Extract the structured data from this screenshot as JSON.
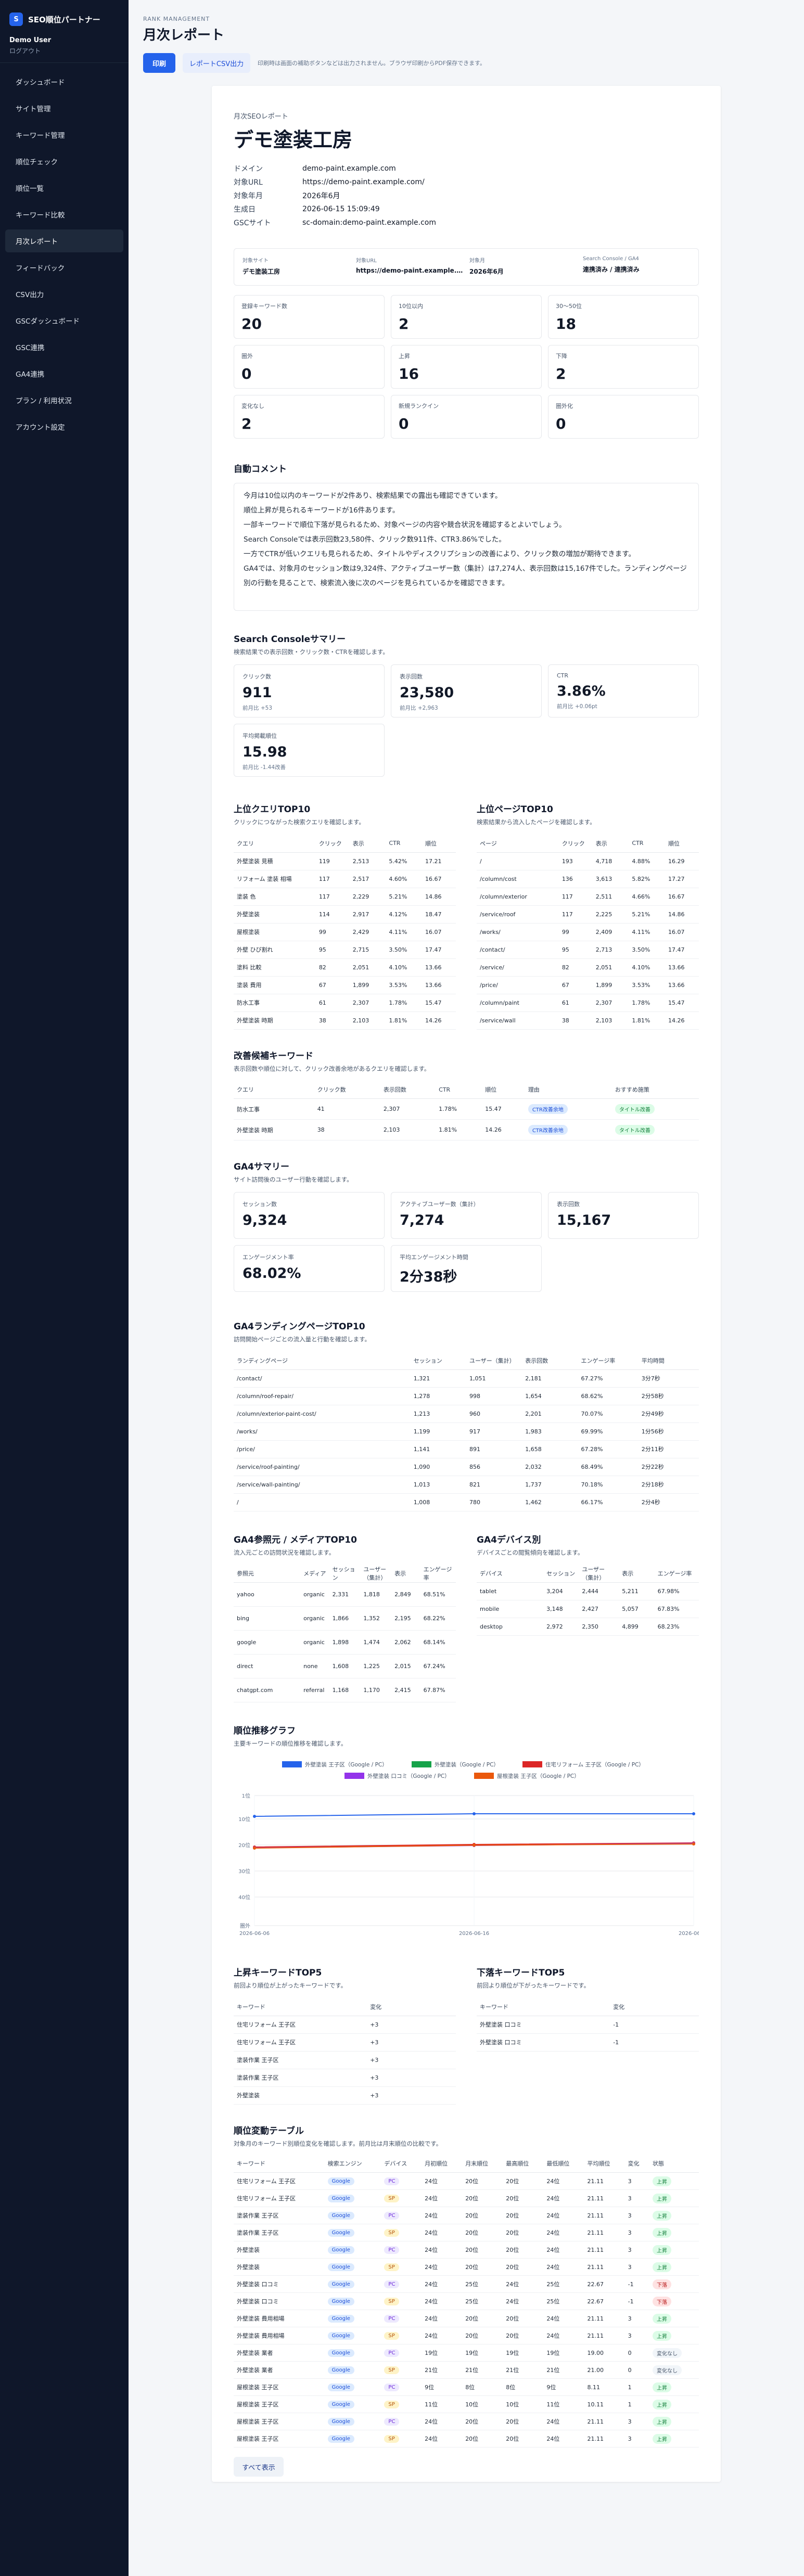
{
  "sidebar": {
    "brand_mark": "S",
    "brand": "SEO順位パートナー",
    "user": "Demo User",
    "logout": "ログアウト",
    "items": [
      "ダッシュボード",
      "サイト管理",
      "キーワード管理",
      "順位チェック",
      "順位一覧",
      "キーワード比較",
      "月次レポート",
      "フィードバック",
      "CSV出力",
      "GSCダッシュボード",
      "GSC連携",
      "GA4連携",
      "プラン / 利用状況",
      "アカウント設定"
    ],
    "active_index": 6
  },
  "header": {
    "crumb": "RANK MANAGEMENT",
    "title": "月次レポート",
    "print": "印刷",
    "csv": "レポートCSV出力",
    "tip": "印刷時は画面の補助ボタンなどは出力されません。ブラウザ印刷からPDF保存できます。"
  },
  "report": {
    "subtitle": "月次SEOレポート",
    "title": "デモ塗装工房",
    "meta": [
      [
        "ドメイン",
        "demo-paint.example.com"
      ],
      [
        "対象URL",
        "https://demo-paint.example.com/"
      ],
      [
        "対象年月",
        "2026年6月"
      ],
      [
        "生成日",
        "2026-06-15 15:09:49"
      ],
      [
        "GSCサイト",
        "sc-domain:demo-paint.example.com"
      ]
    ],
    "info": [
      [
        "対象サイト",
        "デモ塗装工房"
      ],
      [
        "対象URL",
        "https://demo-paint.example.com/"
      ],
      [
        "対象月",
        "2026年6月"
      ],
      [
        "Search Console / GA4",
        "連携済み / 連携済み"
      ]
    ],
    "stats": [
      [
        "登録キーワード数",
        "20"
      ],
      [
        "10位以内",
        "2"
      ],
      [
        "圏外",
        ""
      ],
      [
        "圏外",
        "0"
      ],
      [
        "上昇",
        "16"
      ],
      [
        "下降",
        "2"
      ],
      [
        "変化なし",
        "2"
      ],
      [
        "新規ランクイン",
        "0"
      ],
      [
        "圏外化",
        "0"
      ]
    ],
    "stats_fix": {
      "third_label": "30～50位",
      "third_value": "18"
    },
    "comment_title": "自動コメント",
    "comment": [
      "今月は10位以内のキーワードが2件あり、検索結果での露出も確認できています。",
      "順位上昇が見られるキーワードが16件あります。",
      "一部キーワードで順位下落が見られるため、対象ページの内容や競合状況を確認するとよいでしょう。",
      "Search Consoleでは表示回数23,580件、クリック数911件、CTR3.86%でした。",
      "一方でCTRが低いクエリも見られるため、タイトルやディスクリプションの改善により、クリック数の増加が期待できます。",
      "GA4では、対象月のセッション数は9,324件、アクティブユーザー数（集計）は7,274人、表示回数は15,167件でした。ランディングページ別の行動を見ることで、検索流入後に次のページを見られているかを確認できます。"
    ],
    "gsc": {
      "title": "Search Consoleサマリー",
      "sub": "検索結果での表示回数・クリック数・CTRを確認します。",
      "cards": [
        [
          "クリック数",
          "911",
          "前月比 +53"
        ],
        [
          "表示回数",
          "23,580",
          "前月比 +2,963"
        ],
        [
          "CTR",
          "3.86%",
          "前月比 +0.06pt"
        ],
        [
          "平均掲載順位",
          "15.98",
          "前月比 -1.44改善"
        ]
      ]
    },
    "queries": {
      "title": "上位クエリTOP10",
      "sub": "クリックにつながった検索クエリを確認します。",
      "cols": [
        "クエリ",
        "クリック",
        "表示",
        "CTR",
        "順位"
      ],
      "rows": [
        [
          "外壁塗装 見積",
          "119",
          "2,513",
          "5.42%",
          "17.21"
        ],
        [
          "リフォーム 塗装 相場",
          "117",
          "2,517",
          "4.60%",
          "16.67"
        ],
        [
          "塗装 色",
          "117",
          "2,229",
          "5.21%",
          "14.86"
        ],
        [
          "外壁塗装",
          "114",
          "2,917",
          "4.12%",
          "18.47"
        ],
        [
          "屋根塗装",
          "99",
          "2,429",
          "4.11%",
          "16.07"
        ],
        [
          "外壁 ひび割れ",
          "95",
          "2,715",
          "3.50%",
          "17.47"
        ],
        [
          "塗料 比較",
          "82",
          "2,051",
          "4.10%",
          "13.66"
        ],
        [
          "塗装 費用",
          "67",
          "1,899",
          "3.53%",
          "13.66"
        ],
        [
          "防水工事",
          "61",
          "2,307",
          "1.78%",
          "15.47"
        ],
        [
          "外壁塗装 時期",
          "38",
          "2,103",
          "1.81%",
          "14.26"
        ]
      ]
    },
    "pages": {
      "title": "上位ページTOP10",
      "sub": "検索結果から流入したページを確認します。",
      "cols": [
        "ページ",
        "クリック",
        "表示",
        "CTR",
        "順位"
      ],
      "rows": [
        [
          "/",
          "193",
          "4,718",
          "4.88%",
          "16.29"
        ],
        [
          "/column/cost",
          "136",
          "3,613",
          "5.82%",
          "17.27"
        ],
        [
          "/column/exterior",
          "117",
          "2,511",
          "4.66%",
          "16.67"
        ],
        [
          "/service/roof",
          "117",
          "2,225",
          "5.21%",
          "14.86"
        ],
        [
          "/works/",
          "99",
          "2,409",
          "4.11%",
          "16.07"
        ],
        [
          "/contact/",
          "95",
          "2,713",
          "3.50%",
          "17.47"
        ],
        [
          "/service/",
          "82",
          "2,051",
          "4.10%",
          "13.66"
        ],
        [
          "/price/",
          "67",
          "1,899",
          "3.53%",
          "13.66"
        ],
        [
          "/column/paint",
          "61",
          "2,307",
          "1.78%",
          "15.47"
        ],
        [
          "/service/wall",
          "38",
          "2,103",
          "1.81%",
          "14.26"
        ]
      ]
    },
    "improve": {
      "title": "改善候補キーワード",
      "sub": "表示回数や順位に対して、クリック改善余地があるクエリを確認します。",
      "cols": [
        "クエリ",
        "クリック数",
        "表示回数",
        "CTR",
        "順位",
        "理由",
        "おすすめ施策"
      ],
      "rows": [
        [
          "防水工事",
          "41",
          "2,307",
          "1.78%",
          "15.47",
          "CTR改善余地",
          "タイトル改善"
        ],
        [
          "外壁塗装 時期",
          "38",
          "2,103",
          "1.81%",
          "14.26",
          "CTR改善余地",
          "タイトル改善"
        ]
      ]
    },
    "ga4": {
      "title": "GA4サマリー",
      "sub": "サイト訪問後のユーザー行動を確認します。",
      "cards": [
        [
          "セッション数",
          "9,324"
        ],
        [
          "アクティブユーザー数（集計）",
          "7,274"
        ],
        [
          "表示回数",
          "15,167"
        ],
        [
          "エンゲージメント率",
          "68.02%"
        ],
        [
          "平均エンゲージメント時間",
          "2分38秒"
        ]
      ]
    },
    "landing": {
      "title": "GA4ランディングページTOP10",
      "sub": "訪問開始ページごとの流入量と行動を確認します。",
      "cols": [
        "ランディングページ",
        "セッション",
        "ユーザー（集計）",
        "表示回数",
        "エンゲージ率",
        "平均時間"
      ],
      "rows": [
        [
          "/contact/",
          "1,321",
          "1,051",
          "2,181",
          "67.27%",
          "3分7秒"
        ],
        [
          "/column/roof-repair/",
          "1,278",
          "998",
          "1,654",
          "68.62%",
          "2分58秒"
        ],
        [
          "/column/exterior-paint-cost/",
          "1,213",
          "960",
          "2,201",
          "70.07%",
          "2分49秒"
        ],
        [
          "/works/",
          "1,199",
          "917",
          "1,983",
          "69.99%",
          "1分56秒"
        ],
        [
          "/price/",
          "1,141",
          "891",
          "1,658",
          "67.28%",
          "2分11秒"
        ],
        [
          "/service/roof-painting/",
          "1,090",
          "856",
          "2,032",
          "68.49%",
          "2分22秒"
        ],
        [
          "/service/wall-painting/",
          "1,013",
          "821",
          "1,737",
          "70.18%",
          "2分18秒"
        ],
        [
          "/",
          "1,008",
          "780",
          "1,462",
          "66.17%",
          "2分4秒"
        ]
      ]
    },
    "sources": {
      "title": "GA4参照元 / メディアTOP10",
      "sub": "流入元ごとの訪問状況を確認します。",
      "cols": [
        "参照元",
        "メディア",
        "セッション",
        "ユーザー（集計）",
        "表示",
        "エンゲージ率"
      ],
      "rows": [
        [
          "yahoo",
          "organic",
          "2,331",
          "1,818",
          "2,849",
          "68.51%"
        ],
        [
          "bing",
          "organic",
          "1,866",
          "1,352",
          "2,195",
          "68.22%"
        ],
        [
          "google",
          "organic",
          "1,898",
          "1,474",
          "2,062",
          "68.14%"
        ],
        [
          "direct",
          "none",
          "1,608",
          "1,225",
          "2,015",
          "67.24%"
        ],
        [
          "chatgpt.com",
          "referral",
          "1,168",
          "1,170",
          "2,415",
          "67.87%"
        ]
      ]
    },
    "devices": {
      "title": "GA4デバイス別",
      "sub": "デバイスごとの閲覧傾向を確認します。",
      "cols": [
        "デバイス",
        "セッション",
        "ユーザー（集計）",
        "表示",
        "エンゲージ率"
      ],
      "rows": [
        [
          "tablet",
          "3,204",
          "2,444",
          "5,211",
          "67.98%"
        ],
        [
          "mobile",
          "3,148",
          "2,427",
          "5,057",
          "67.83%"
        ],
        [
          "desktop",
          "2,972",
          "2,350",
          "4,899",
          "68.23%"
        ]
      ]
    },
    "rankchart": {
      "title": "順位推移グラフ",
      "sub": "主要キーワードの順位推移を確認します。"
    },
    "up5": {
      "title": "上昇キーワードTOP5",
      "sub": "前回より順位が上がったキーワードです。",
      "cols": [
        "キーワード",
        "変化"
      ],
      "rows": [
        [
          "住宅リフォーム 王子区",
          "+3"
        ],
        [
          "住宅リフォーム 王子区",
          "+3"
        ],
        [
          "塗装作業 王子区",
          "+3"
        ],
        [
          "塗装作業 王子区",
          "+3"
        ],
        [
          "外壁塗装",
          "+3"
        ]
      ]
    },
    "down5": {
      "title": "下落キーワードTOP5",
      "sub": "前回より順位が下がったキーワードです。",
      "cols": [
        "キーワード",
        "変化"
      ],
      "rows": [
        [
          "外壁塗装 口コミ",
          "-1"
        ],
        [
          "外壁塗装 口コミ",
          "-1"
        ]
      ]
    },
    "changes": {
      "title": "順位変動テーブル",
      "sub": "対象月のキーワード別順位変化を確認します。前月比は月末順位の比較です。",
      "cols": [
        "キーワード",
        "検索エンジン",
        "デバイス",
        "月初順位",
        "月末順位",
        "最高順位",
        "最低順位",
        "平均順位",
        "変化",
        "状態"
      ],
      "rows": [
        [
          "住宅リフォーム 王子区",
          "Google",
          "PC",
          "24位",
          "20位",
          "20位",
          "24位",
          "21.11",
          "3",
          "上昇"
        ],
        [
          "住宅リフォーム 王子区",
          "Google",
          "SP",
          "24位",
          "20位",
          "20位",
          "24位",
          "21.11",
          "3",
          "上昇"
        ],
        [
          "塗装作業 王子区",
          "Google",
          "PC",
          "24位",
          "20位",
          "20位",
          "24位",
          "21.11",
          "3",
          "上昇"
        ],
        [
          "塗装作業 王子区",
          "Google",
          "SP",
          "24位",
          "20位",
          "20位",
          "24位",
          "21.11",
          "3",
          "上昇"
        ],
        [
          "外壁塗装",
          "Google",
          "PC",
          "24位",
          "20位",
          "20位",
          "24位",
          "21.11",
          "3",
          "上昇"
        ],
        [
          "外壁塗装",
          "Google",
          "SP",
          "24位",
          "20位",
          "20位",
          "24位",
          "21.11",
          "3",
          "上昇"
        ],
        [
          "外壁塗装 口コミ",
          "Google",
          "PC",
          "24位",
          "25位",
          "24位",
          "25位",
          "22.67",
          "-1",
          "下落"
        ],
        [
          "外壁塗装 口コミ",
          "Google",
          "SP",
          "24位",
          "25位",
          "24位",
          "25位",
          "22.67",
          "-1",
          "下落"
        ],
        [
          "外壁塗装 費用相場",
          "Google",
          "PC",
          "24位",
          "20位",
          "20位",
          "24位",
          "21.11",
          "3",
          "上昇"
        ],
        [
          "外壁塗装 費用相場",
          "Google",
          "SP",
          "24位",
          "20位",
          "20位",
          "24位",
          "21.11",
          "3",
          "上昇"
        ],
        [
          "外壁塗装 業者",
          "Google",
          "PC",
          "19位",
          "19位",
          "19位",
          "19位",
          "19.00",
          "0",
          "変化なし"
        ],
        [
          "外壁塗装 業者",
          "Google",
          "SP",
          "21位",
          "21位",
          "21位",
          "21位",
          "21.00",
          "0",
          "変化なし"
        ],
        [
          "屋根塗装 王子区",
          "Google",
          "PC",
          "9位",
          "8位",
          "8位",
          "9位",
          "8.11",
          "1",
          "上昇"
        ],
        [
          "屋根塗装 王子区",
          "Google",
          "SP",
          "11位",
          "10位",
          "10位",
          "11位",
          "10.11",
          "1",
          "上昇"
        ],
        [
          "屋根塗装 王子区",
          "Google",
          "PC",
          "24位",
          "20位",
          "20位",
          "24位",
          "21.11",
          "3",
          "上昇"
        ],
        [
          "屋根塗装 王子区",
          "Google",
          "SP",
          "24位",
          "20位",
          "20位",
          "24位",
          "21.11",
          "3",
          "上昇"
        ]
      ]
    },
    "show_all": "すべて表示"
  },
  "chart_data": {
    "type": "line",
    "title": "",
    "xlabel": "",
    "ylabel": "",
    "x": [
      "2026-06-06",
      "2026-06-16",
      "2026-06-26"
    ],
    "y_ticks": [
      "1位",
      "10位",
      "20位",
      "30位",
      "40位",
      "圏外"
    ],
    "ylim": [
      1,
      51
    ],
    "series": [
      {
        "name": "外壁塗装 王子区（Google / PC）",
        "color": "#2563eb",
        "values": [
          9,
          8,
          8
        ]
      },
      {
        "name": "外壁塗装（Google / PC）",
        "color": "#16a34a",
        "values": [
          21,
          20,
          19.5
        ]
      },
      {
        "name": "住宅リフォーム 王子区（Google / PC）",
        "color": "#dc2626",
        "values": [
          20.8,
          19.8,
          19.2
        ]
      },
      {
        "name": "外壁塗装 口コミ（Google / PC）",
        "color": "#9333ea",
        "values": [
          21.1,
          20.2,
          19.4
        ]
      },
      {
        "name": "屋根塗装 王子区（Google / PC）",
        "color": "#ea580c",
        "values": [
          21.2,
          20.1,
          19.6
        ]
      }
    ]
  }
}
